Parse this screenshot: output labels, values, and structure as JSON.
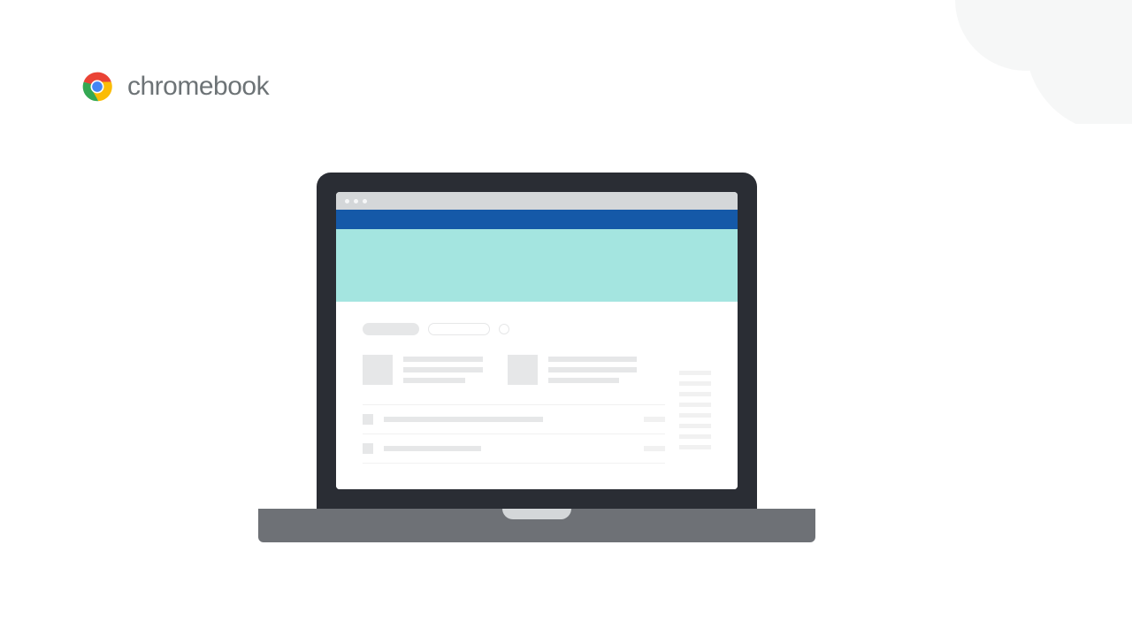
{
  "brand": {
    "name": "chromebook"
  }
}
